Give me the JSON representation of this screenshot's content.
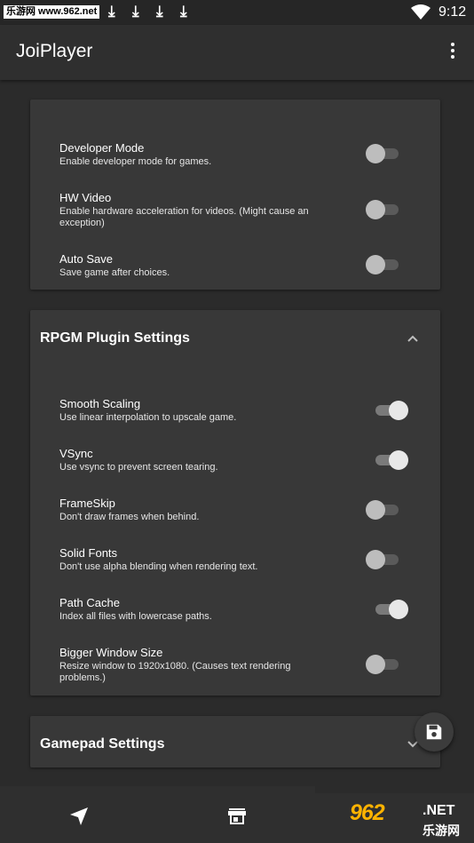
{
  "status_bar": {
    "site": "乐游网 www.962.net",
    "time": "9:12",
    "icons": [
      "download-icon",
      "download-icon",
      "download-icon",
      "download-icon",
      "wifi-icon"
    ]
  },
  "app_bar": {
    "title": "JoiPlayer",
    "menu_icon": "more-vert-icon"
  },
  "general_card": {
    "settings": [
      {
        "title": "Developer Mode",
        "subtitle": "Enable developer mode for games.",
        "enabled": false
      },
      {
        "title": "HW Video",
        "subtitle": "Enable hardware acceleration for videos. (Might cause an exception)",
        "enabled": false
      },
      {
        "title": "Auto Save",
        "subtitle": "Save game after choices.",
        "enabled": false
      }
    ]
  },
  "rpgm_card": {
    "title": "RPGM Plugin Settings",
    "expanded": true,
    "settings": [
      {
        "title": "Smooth Scaling",
        "subtitle": "Use linear interpolation to upscale game.",
        "enabled": true
      },
      {
        "title": "VSync",
        "subtitle": "Use vsync to prevent screen tearing.",
        "enabled": true
      },
      {
        "title": "FrameSkip",
        "subtitle": "Don't draw frames when behind.",
        "enabled": false
      },
      {
        "title": "Solid Fonts",
        "subtitle": "Don't use alpha blending when rendering text.",
        "enabled": false
      },
      {
        "title": "Path Cache",
        "subtitle": "Index all files with lowercase paths.",
        "enabled": true
      },
      {
        "title": "Bigger Window Size",
        "subtitle": "Resize window to 1920x1080. (Causes text rendering problems.)",
        "enabled": false
      }
    ]
  },
  "gamepad_card": {
    "title": "Gamepad Settings",
    "expanded": false
  },
  "fab": {
    "icon": "save-icon"
  },
  "bottom_nav": {
    "items": [
      {
        "icon": "navigation-icon"
      },
      {
        "icon": "store-icon"
      }
    ]
  },
  "watermark": {
    "logo": "962",
    "net": ".NET",
    "cn": "乐游网"
  },
  "colors": {
    "background": "#2b2b2b",
    "card": "#383838",
    "appbar": "#2f2f2f",
    "switch_on": "#e8e8e8",
    "switch_off": "#bdbdbd"
  }
}
